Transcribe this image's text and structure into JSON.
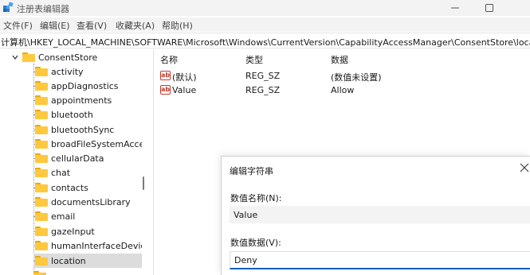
{
  "window": {
    "title": "注册表编辑器"
  },
  "menu": [
    "文件(F)",
    "编辑(E)",
    "查看(V)",
    "收藏夹(A)",
    "帮助(H)"
  ],
  "address": "计算机\\HKEY_LOCAL_MACHINE\\SOFTWARE\\Microsoft\\Windows\\CurrentVersion\\CapabilityAccessManager\\ConsentStore\\location",
  "tree": {
    "parent": "ConsentStore",
    "children": [
      "activity",
      "appDiagnostics",
      "appointments",
      "bluetooth",
      "bluetoothSync",
      "broadFileSystemAcces",
      "cellularData",
      "chat",
      "contacts",
      "documentsLibrary",
      "email",
      "gazeInput",
      "humanInterfaceDevice",
      "location"
    ],
    "selected": "location"
  },
  "values": {
    "columns": [
      "名称",
      "类型",
      "数据"
    ],
    "rows": [
      {
        "name": "(默认)",
        "type": "REG_SZ",
        "data": "(数值未设置)"
      },
      {
        "name": "Value",
        "type": "REG_SZ",
        "data": "Allow"
      }
    ]
  },
  "dialog": {
    "title": "编辑字符串",
    "name_label": "数值名称(N):",
    "name_value": "Value",
    "data_label": "数值数据(V):",
    "data_value": "Deny"
  },
  "icons": {
    "app": "registry-editor-icon",
    "minimize": "minimize-icon",
    "maximize": "maximize-icon",
    "folder": "folder-icon",
    "string_value": "string-value-icon",
    "close": "close-icon"
  },
  "colors": {
    "folder": "#ffc83d",
    "selection": "#dcdcdc",
    "focus_underline": "#005fb8",
    "string_icon": "#c23b2e"
  }
}
